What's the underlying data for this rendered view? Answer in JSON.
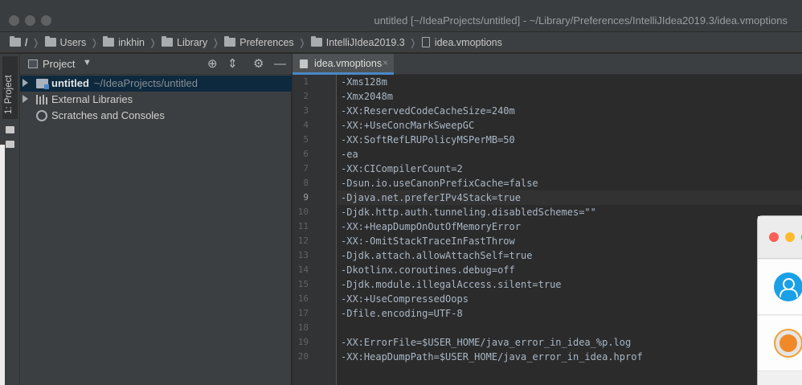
{
  "window": {
    "title": "untitled [~/IdeaProjects/untitled] - ~/Library/Preferences/IntelliJIdea2019.3/idea.vmoptions"
  },
  "breadcrumb": {
    "items": [
      {
        "label": "/",
        "icon": "folder-icon"
      },
      {
        "label": "Users",
        "icon": "folder-icon"
      },
      {
        "label": "inkhin",
        "icon": "folder-icon"
      },
      {
        "label": "Library",
        "icon": "folder-icon"
      },
      {
        "label": "Preferences",
        "icon": "folder-icon"
      },
      {
        "label": "IntelliJIdea2019.3",
        "icon": "folder-icon"
      },
      {
        "label": "idea.vmoptions",
        "icon": "file-icon"
      }
    ]
  },
  "tool_strip": {
    "project_tab_label": "1: Project"
  },
  "project_panel": {
    "title": "Project",
    "dropdown_caret": "▼",
    "header_icons": [
      "target-icon",
      "collapse-all-icon",
      "gear-icon",
      "minimize-icon"
    ],
    "tree": [
      {
        "label": "untitled",
        "path": "~/IdeaProjects/untitled",
        "icon": "module-folder-icon",
        "expandable": true,
        "selected": true
      },
      {
        "label": "External Libraries",
        "path": "",
        "icon": "libraries-icon",
        "expandable": true,
        "selected": false
      },
      {
        "label": "Scratches and Consoles",
        "path": "",
        "icon": "scratches-icon",
        "expandable": false,
        "selected": false
      }
    ]
  },
  "editor": {
    "tab_label": "idea.vmoptions",
    "close_glyph": "×",
    "current_line": 9,
    "lines": [
      "-Xms128m",
      "-Xmx2048m",
      "-XX:ReservedCodeCacheSize=240m",
      "-XX:+UseConcMarkSweepGC",
      "-XX:SoftRefLRUPolicyMSPerMB=50",
      "-ea",
      "-XX:CICompilerCount=2",
      "-Dsun.io.useCanonPrefixCache=false",
      "-Djava.net.preferIPv4Stack=true",
      "-Djdk.http.auth.tunneling.disabledSchemes=\"\"",
      "-XX:+HeapDumpOnOutOfMemoryError",
      "-XX:-OmitStackTraceInFastThrow",
      "-Djdk.attach.allowAttachSelf=true",
      "-Dkotlinx.coroutines.debug=off",
      "-Djdk.module.illegalAccess.silent=true",
      "-XX:+UseCompressedOops",
      "-Dfile.encoding=UTF-8",
      "",
      "-XX:ErrorFile=$USER_HOME/java_error_in_idea_%p.log",
      "-XX:HeapDumpPath=$USER_HOME/java_error_in_idea.hprof"
    ]
  },
  "colors": {
    "accent": "#4a88c7",
    "selection": "#0d293e",
    "editor_bg": "#2b2b2b",
    "panel_bg": "#3c3f41",
    "code_text": "#a9b7c6"
  }
}
